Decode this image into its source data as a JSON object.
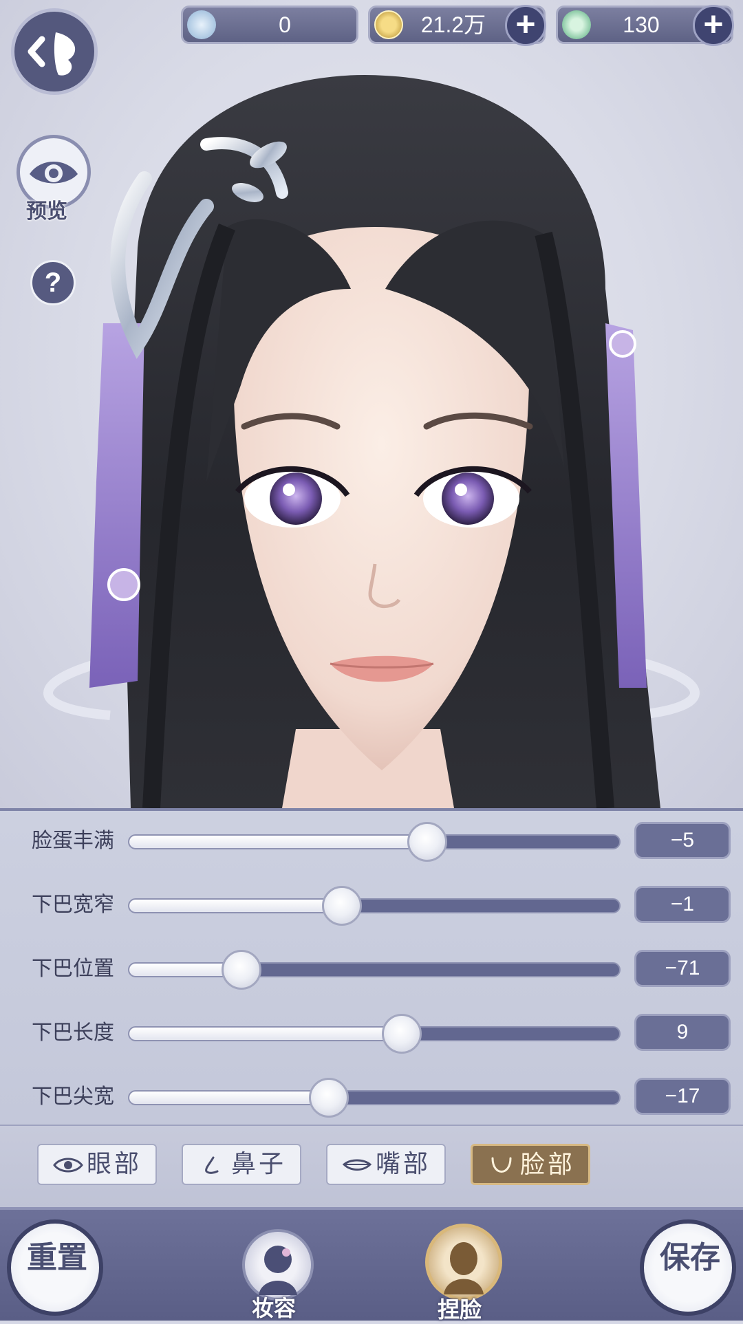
{
  "currencies": [
    {
      "name": "jade",
      "value": "0",
      "has_plus": false,
      "color": "#cfe3f4"
    },
    {
      "name": "coin",
      "value": "21.2万",
      "has_plus": true,
      "color": "#e8c55a"
    },
    {
      "name": "spirit",
      "value": "130",
      "has_plus": true,
      "color": "#8fd4a8"
    }
  ],
  "side": {
    "preview_label": "预览",
    "help_symbol": "?"
  },
  "sliders": [
    {
      "label": "脸蛋丰满",
      "value": "−5",
      "position": 0.608
    },
    {
      "label": "下巴宽窄",
      "value": "−1",
      "position": 0.434
    },
    {
      "label": "下巴位置",
      "value": "−71",
      "position": 0.23
    },
    {
      "label": "下巴长度",
      "value": "9",
      "position": 0.556
    },
    {
      "label": "下巴尖宽",
      "value": "−17",
      "position": 0.408
    }
  ],
  "tabs": [
    {
      "label": "眼部",
      "icon": "eye-icon",
      "active": false
    },
    {
      "label": "鼻子",
      "icon": "nose-icon",
      "active": false
    },
    {
      "label": "嘴部",
      "icon": "mouth-icon",
      "active": false
    },
    {
      "label": "脸部",
      "icon": "face-icon",
      "active": true
    }
  ],
  "bottom": {
    "reset_label": "重置",
    "makeup_label": "妆容",
    "face_label": "捏脸",
    "save_label": "保存"
  },
  "colors": {
    "panel": "#c4c8da",
    "track": "#626790",
    "accent": "#8a7150",
    "bar": "#5a5e86"
  }
}
